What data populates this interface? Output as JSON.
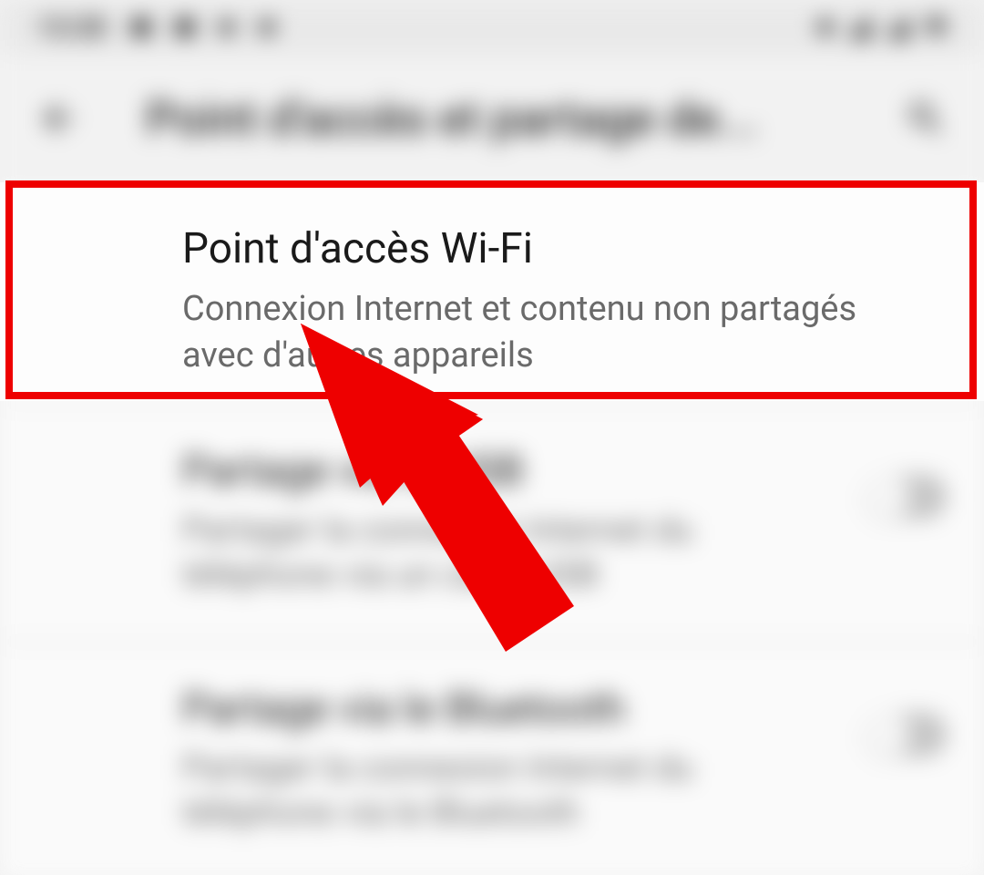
{
  "status_bar": {
    "time": "13:28"
  },
  "app_bar": {
    "title": "Point d'accès et partage de..."
  },
  "items": [
    {
      "title": "Point d'accès Wi-Fi",
      "sub": "Connexion Internet et contenu non partagés avec d'autres appareils",
      "has_toggle": false
    },
    {
      "title": "Partage via le USB",
      "sub": "Partager la connexion Internet du téléphone via un câble USB",
      "has_toggle": true
    },
    {
      "title": "Partage via le Bluetooth",
      "sub": "Partager la connexion Internet du téléphone via le Bluetooth",
      "has_toggle": true
    }
  ],
  "annotation": {
    "highlight_color": "#ee0000",
    "target_item_index": 0
  }
}
